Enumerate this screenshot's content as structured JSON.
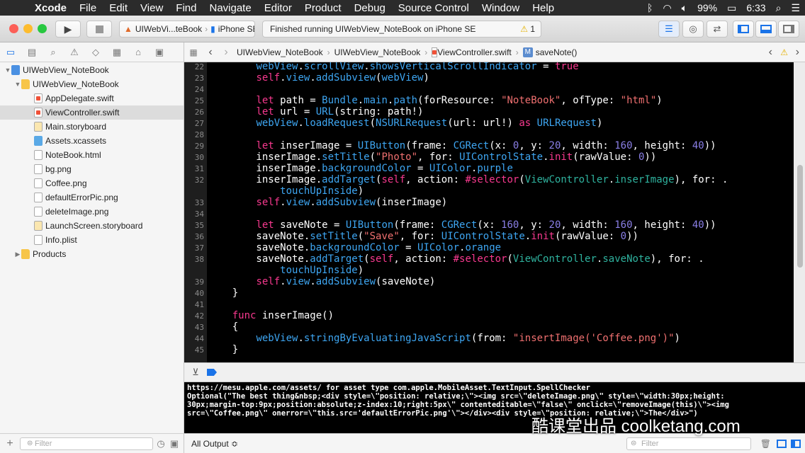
{
  "menubar": {
    "app": "Xcode",
    "items": [
      "File",
      "Edit",
      "View",
      "Find",
      "Navigate",
      "Editor",
      "Product",
      "Debug",
      "Source Control",
      "Window",
      "Help"
    ],
    "battery": "99%",
    "time": "6:33"
  },
  "toolbar": {
    "scheme_target": "UIWebVi...teBook",
    "scheme_device": "iPhone SE",
    "status_text": "Finished running UIWebView_NoteBook on iPhone SE",
    "warning_count": "1"
  },
  "navigator": {
    "items": [
      {
        "label": "UIWebView_NoteBook",
        "icon": "project-icon"
      },
      {
        "label": "UIWebView_NoteBook",
        "icon": "folder-icon"
      },
      {
        "label": "AppDelegate.swift",
        "icon": "swift-file-icon"
      },
      {
        "label": "ViewController.swift",
        "icon": "swift-file-icon",
        "selected": true
      },
      {
        "label": "Main.storyboard",
        "icon": "storyboard-icon"
      },
      {
        "label": "Assets.xcassets",
        "icon": "assets-icon"
      },
      {
        "label": "NoteBook.html",
        "icon": "file-icon"
      },
      {
        "label": "bg.png",
        "icon": "image-icon"
      },
      {
        "label": "Coffee.png",
        "icon": "image-icon"
      },
      {
        "label": "defaultErrorPic.png",
        "icon": "image-icon"
      },
      {
        "label": "deleteImage.png",
        "icon": "image-icon"
      },
      {
        "label": "LaunchScreen.storyboard",
        "icon": "storyboard-icon"
      },
      {
        "label": "Info.plist",
        "icon": "plist-icon"
      },
      {
        "label": "Products",
        "icon": "folder-icon"
      }
    ],
    "filter_placeholder": "Filter"
  },
  "jumpbar": {
    "crumbs": [
      "UIWebView_NoteBook",
      "UIWebView_NoteBook",
      "ViewController.swift",
      "saveNote()"
    ],
    "method_badge": "M"
  },
  "editor": {
    "lines": [
      {
        "n": "22",
        "html": "        <span class='t'>webView</span>.<span class='t'>scrollView</span>.<span class='t'>showsVerticalScrollIndicator</span> = <span class='k'>true</span>"
      },
      {
        "n": "23",
        "html": "        <span class='k'>self</span>.<span class='t'>view</span>.<span class='t'>addSubview</span>(<span class='t'>webView</span>)"
      },
      {
        "n": "24",
        "html": ""
      },
      {
        "n": "25",
        "html": "        <span class='k'>let</span> path = <span class='t'>Bundle</span>.<span class='t'>main</span>.<span class='t'>path</span>(forResource: <span class='s'>\"NoteBook\"</span>, ofType: <span class='s'>\"html\"</span>)"
      },
      {
        "n": "26",
        "html": "        <span class='k'>let</span> url = <span class='t'>URL</span>(string: path!)"
      },
      {
        "n": "27",
        "html": "        <span class='t'>webView</span>.<span class='t'>loadRequest</span>(<span class='t'>NSURLRequest</span>(url: url!) <span class='k'>as</span> <span class='t'>URLRequest</span>)"
      },
      {
        "n": "28",
        "html": ""
      },
      {
        "n": "29",
        "html": "        <span class='k'>let</span> inserImage = <span class='t'>UIButton</span>(frame: <span class='t'>CGRect</span>(x: <span class='n'>0</span>, y: <span class='n'>20</span>, width: <span class='n'>160</span>, height: <span class='n'>40</span>))"
      },
      {
        "n": "30",
        "html": "        inserImage.<span class='t'>setTitle</span>(<span class='s'>\"Photo\"</span>, for: <span class='t'>UIControlState</span>.<span class='k'>init</span>(rawValue: <span class='n'>0</span>))"
      },
      {
        "n": "31",
        "html": "        inserImage.<span class='t'>backgroundColor</span> = <span class='t'>UIColor</span>.<span class='t'>purple</span>"
      },
      {
        "n": "32",
        "html": "        inserImage.<span class='t'>addTarget</span>(<span class='k'>self</span>, action: <span class='k'>#selector</span>(<span class='m'>ViewController</span>.<span class='m'>inserImage</span>), for: ."
      },
      {
        "n": "",
        "html": "            <span class='t'>touchUpInside</span>)"
      },
      {
        "n": "33",
        "html": "        <span class='k'>self</span>.<span class='t'>view</span>.<span class='t'>addSubview</span>(inserImage)"
      },
      {
        "n": "34",
        "html": ""
      },
      {
        "n": "35",
        "html": "        <span class='k'>let</span> saveNote = <span class='t'>UIButton</span>(frame: <span class='t'>CGRect</span>(x: <span class='n'>160</span>, y: <span class='n'>20</span>, width: <span class='n'>160</span>, height: <span class='n'>40</span>))"
      },
      {
        "n": "36",
        "html": "        saveNote.<span class='t'>setTitle</span>(<span class='s'>\"Save\"</span>, for: <span class='t'>UIControlState</span>.<span class='k'>init</span>(rawValue: <span class='n'>0</span>))"
      },
      {
        "n": "37",
        "html": "        saveNote.<span class='t'>backgroundColor</span> = <span class='t'>UIColor</span>.<span class='t'>orange</span>"
      },
      {
        "n": "38",
        "html": "        saveNote.<span class='t'>addTarget</span>(<span class='k'>self</span>, action: <span class='k'>#selector</span>(<span class='m'>ViewController</span>.<span class='m'>saveNote</span>), for: ."
      },
      {
        "n": "",
        "html": "            <span class='t'>touchUpInside</span>)"
      },
      {
        "n": "39",
        "html": "        <span class='k'>self</span>.<span class='t'>view</span>.<span class='t'>addSubview</span>(saveNote)"
      },
      {
        "n": "40",
        "html": "    }"
      },
      {
        "n": "41",
        "html": ""
      },
      {
        "n": "42",
        "html": "    <span class='k'>func</span> inserImage()"
      },
      {
        "n": "43",
        "html": "    {"
      },
      {
        "n": "44",
        "html": "        <span class='t'>webView</span>.<span class='t'>stringByEvaluatingJavaScript</span>(from: <span class='s'>\"insertImage('Coffee.png')\"</span>)"
      },
      {
        "n": "45",
        "html": "    }"
      }
    ]
  },
  "console": {
    "text": "https://mesu.apple.com/assets/ for asset type com.apple.MobileAsset.TextInput.SpellChecker\nOptional(\"The best thing&nbsp;<div style=\\\"position: relative;\\\"><img src=\\\"deleteImage.png\\\" style=\\\"width:30px;height:\n30px;margin-top:9px;position:absolute;z-index:10;right:5px\\\" contenteditable=\\\"false\\\" onclick=\\\"removeImage(this)\\\"><img\nsrc=\\\"Coffee.png\\\" onerror=\\\"this.src='defaultErrorPic.png'\\\"></div><div style=\\\"position: relative;\\\">The</div>\")",
    "output_selector": "All Output ≎",
    "filter_placeholder": "Filter"
  },
  "watermark": "酷课堂出品 coolketang.com"
}
